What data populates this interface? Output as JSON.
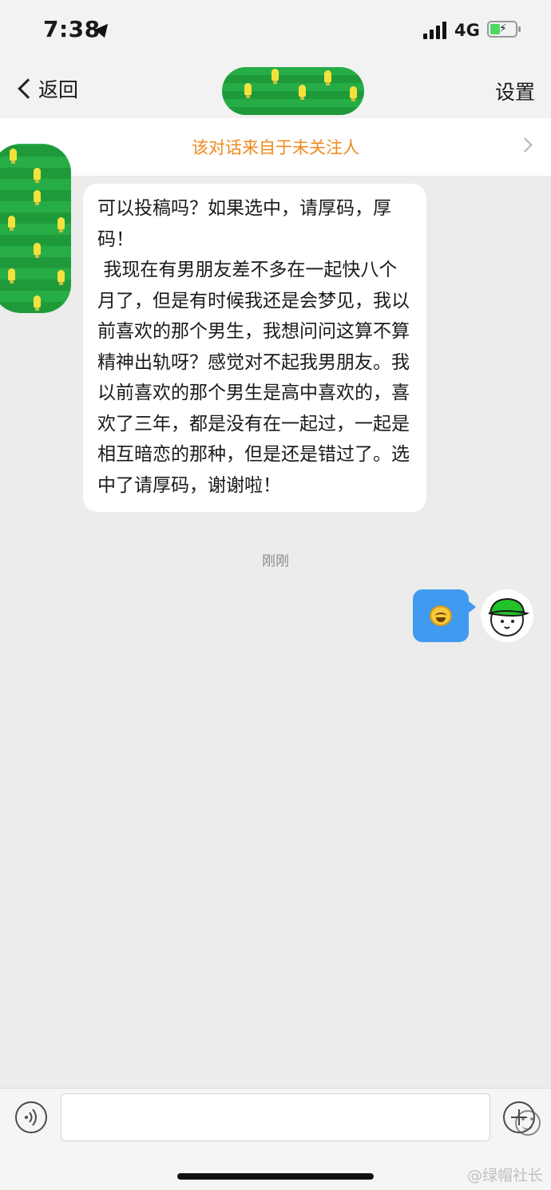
{
  "status_bar": {
    "time": "7:38",
    "network": "4G"
  },
  "nav": {
    "back_label": "返回",
    "settings_label": "设置"
  },
  "notice": {
    "text": "该对话来自于未关注人"
  },
  "conversation": {
    "incoming_message": "可以投稿吗？如果选中，请厚码，厚码！\n 我现在有男朋友差不多在一起快八个月了，但是有时候我还是会梦见，我以前喜欢的那个男生，我想问问这算不算精神出轨呀？感觉对不起我男朋友。我以前喜欢的那个男生是高中喜欢的，喜欢了三年，都是没有在一起过，一起是相互暗恋的那种，但是还是错过了。选中了请厚码，谢谢啦！",
    "timestamp": "刚刚"
  },
  "input_bar": {
    "watermark": "@绿帽社长"
  },
  "colors": {
    "notice_text": "#f08a1c",
    "outgoing_bubble": "#3f9af0",
    "avatar_green": "#27ad45"
  }
}
